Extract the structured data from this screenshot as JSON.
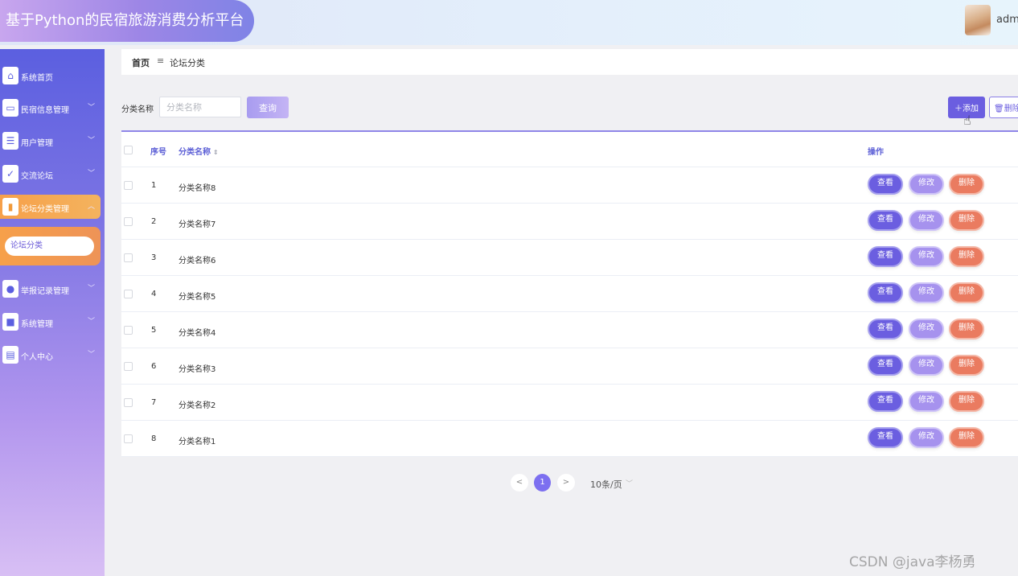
{
  "header": {
    "title": "基于Python的民宿旅游消费分析平台",
    "user": "admi"
  },
  "sidebar": {
    "items": [
      {
        "label": "系统首页",
        "icon": "home-icon"
      },
      {
        "label": "民宿信息管理",
        "icon": "monitor-icon"
      },
      {
        "label": "用户管理",
        "icon": "sliders-icon"
      },
      {
        "label": "交流论坛",
        "icon": "clipboard-check-icon"
      },
      {
        "label": "论坛分类管理",
        "icon": "book-icon",
        "active": true
      },
      {
        "label": "举报记录管理",
        "icon": "balloon-icon"
      },
      {
        "label": "系统管理",
        "icon": "briefcase-icon"
      },
      {
        "label": "个人中心",
        "icon": "card-icon"
      }
    ],
    "sub_item": "论坛分类"
  },
  "breadcrumb": {
    "home": "首页",
    "separator": "≡",
    "current": "论坛分类"
  },
  "search": {
    "label": "分类名称",
    "placeholder": "分类名称",
    "value": "",
    "query_button": "查询"
  },
  "toolbar": {
    "add_button": "添加",
    "delete_button": "删除"
  },
  "table": {
    "headers": {
      "index": "序号",
      "name": "分类名称",
      "actions": "操作"
    },
    "rows": [
      {
        "index": "1",
        "name": "分类名称8"
      },
      {
        "index": "2",
        "name": "分类名称7"
      },
      {
        "index": "3",
        "name": "分类名称6"
      },
      {
        "index": "4",
        "name": "分类名称5"
      },
      {
        "index": "5",
        "name": "分类名称4"
      },
      {
        "index": "6",
        "name": "分类名称3"
      },
      {
        "index": "7",
        "name": "分类名称2"
      },
      {
        "index": "8",
        "name": "分类名称1"
      }
    ],
    "actions": {
      "view": "查看",
      "edit": "修改",
      "delete": "删除"
    }
  },
  "pagination": {
    "prev": "<",
    "current_page": "1",
    "next": ">",
    "page_size": "10条/页"
  },
  "watermark": "CSDN @java李杨勇",
  "colors": {
    "accent": "#6b5ee0",
    "danger": "#ea7b60",
    "active_menu": "#f6a04a"
  }
}
